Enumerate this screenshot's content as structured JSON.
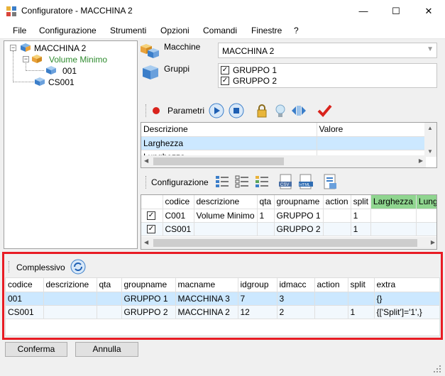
{
  "window": {
    "title": "Configuratore - MACCHINA 2",
    "min": "—",
    "max": "☐",
    "close": "✕"
  },
  "menu": [
    "File",
    "Configurazione",
    "Strumenti",
    "Opzioni",
    "Comandi",
    "Finestre",
    "?"
  ],
  "tree": {
    "root": "MACCHINA 2",
    "child": "Volume Minimo",
    "grandchild": "001",
    "sibling": "CS001"
  },
  "machines": {
    "label": "Macchine",
    "value": "MACCHINA 2"
  },
  "groups": {
    "label": "Gruppi",
    "items": [
      "GRUPPO 1",
      "GRUPPO 2"
    ]
  },
  "params": {
    "title": "Parametri",
    "headers": [
      "Descrizione",
      "Valore"
    ],
    "rows": [
      "Larghezza",
      "Lunghezza"
    ]
  },
  "config": {
    "title": "Configurazione",
    "headers": [
      "codice",
      "descrizione",
      "qta",
      "groupname",
      "action",
      "split",
      "Larghezza",
      "Lunghe"
    ],
    "rows": [
      [
        "C001",
        "Volume Minimo",
        "1",
        "GRUPPO 1",
        "",
        "1"
      ],
      [
        "CS001",
        "",
        "",
        "GRUPPO 2",
        "",
        "1"
      ]
    ]
  },
  "complessivo": {
    "title": "Complessivo",
    "headers": [
      "codice",
      "descrizione",
      "qta",
      "groupname",
      "macname",
      "idgroup",
      "idmacc",
      "action",
      "split",
      "extra"
    ],
    "rows": [
      [
        "001",
        "",
        "",
        "GRUPPO 1",
        "MACCHINA 3",
        "7",
        "3",
        "",
        "",
        "{}"
      ],
      [
        "CS001",
        "",
        "",
        "GRUPPO 2",
        "MACCHINA 2",
        "12",
        "2",
        "",
        "1",
        "{['Split']='1',}"
      ]
    ]
  },
  "buttons": {
    "confirm": "Conferma",
    "cancel": "Annulla"
  }
}
